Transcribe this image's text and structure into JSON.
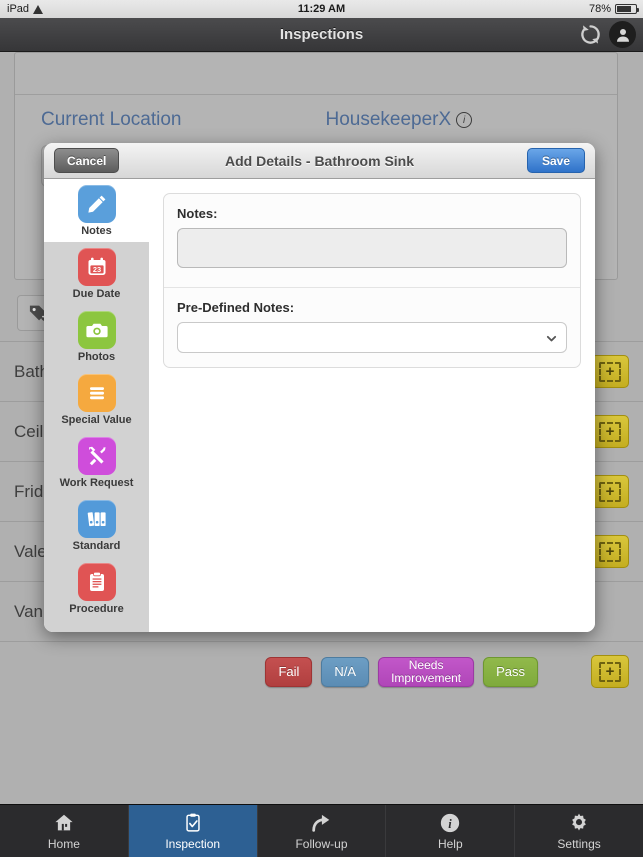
{
  "statusbar": {
    "device": "iPad",
    "wifi_icon": "wifi-icon",
    "time": "11:29 AM",
    "battery_percent": "78%",
    "battery_icon": "battery-icon"
  },
  "navbar": {
    "title": "Inspections",
    "refresh_icon": "refresh-icon",
    "account_icon": "account-icon"
  },
  "page": {
    "current_location_label": "Current Location",
    "housekeeper_label": "HousekeeperX",
    "info_badge": "i",
    "tag_icon": "tag-add-icon",
    "rows": [
      {
        "label": "Bathro",
        "plus": "+"
      },
      {
        "label": "Ceiling",
        "plus": "+"
      },
      {
        "label": "Fridge",
        "plus": "+"
      },
      {
        "label": "Valet B",
        "plus": "+"
      },
      {
        "label": "Vanity c",
        "plus": "+"
      }
    ],
    "status_buttons": [
      {
        "label": "Fail",
        "color": "#b94747"
      },
      {
        "label": "N/A",
        "color": "#5b8cb4"
      },
      {
        "label": "Needs Improvement",
        "color": "#b649be"
      },
      {
        "label": "Pass",
        "color": "#82ad3f"
      }
    ],
    "status_plus": "+"
  },
  "modal": {
    "cancel_label": "Cancel",
    "title": "Add Details - Bathroom Sink",
    "save_label": "Save",
    "save_color": "#2f72c9",
    "sidebar": [
      {
        "label": "Notes",
        "icon": "pencil-icon",
        "color": "#5a9fdb",
        "active": true
      },
      {
        "label": "Due Date",
        "icon": "calendar-icon",
        "color": "#e05454",
        "active": false,
        "day": "23"
      },
      {
        "label": "Photos",
        "icon": "camera-icon",
        "color": "#8cc63f",
        "active": false
      },
      {
        "label": "Special Value",
        "icon": "list-icon",
        "color": "#f5a93f",
        "active": false
      },
      {
        "label": "Work Request",
        "icon": "tools-icon",
        "color": "#cf4ddb",
        "active": false
      },
      {
        "label": "Standard",
        "icon": "binders-icon",
        "color": "#539ad9",
        "active": false
      },
      {
        "label": "Procedure",
        "icon": "clipboard-icon",
        "color": "#e05454",
        "active": false
      }
    ],
    "form": {
      "notes_label": "Notes:",
      "notes_value": "",
      "notes_placeholder": "",
      "predefined_label": "Pre-Defined Notes:",
      "predefined_value": "",
      "predefined_placeholder": "",
      "chevron_icon": "chevron-down-icon"
    }
  },
  "tabbar": {
    "tabs": [
      {
        "label": "Home",
        "icon": "home-icon",
        "active": false
      },
      {
        "label": "Inspection",
        "icon": "clipboard-check-icon",
        "active": true
      },
      {
        "label": "Follow-up",
        "icon": "arrow-forward-icon",
        "active": false
      },
      {
        "label": "Help",
        "icon": "info-icon",
        "active": false
      },
      {
        "label": "Settings",
        "icon": "gear-icon",
        "active": false
      }
    ],
    "active_color": "#2d6093"
  }
}
